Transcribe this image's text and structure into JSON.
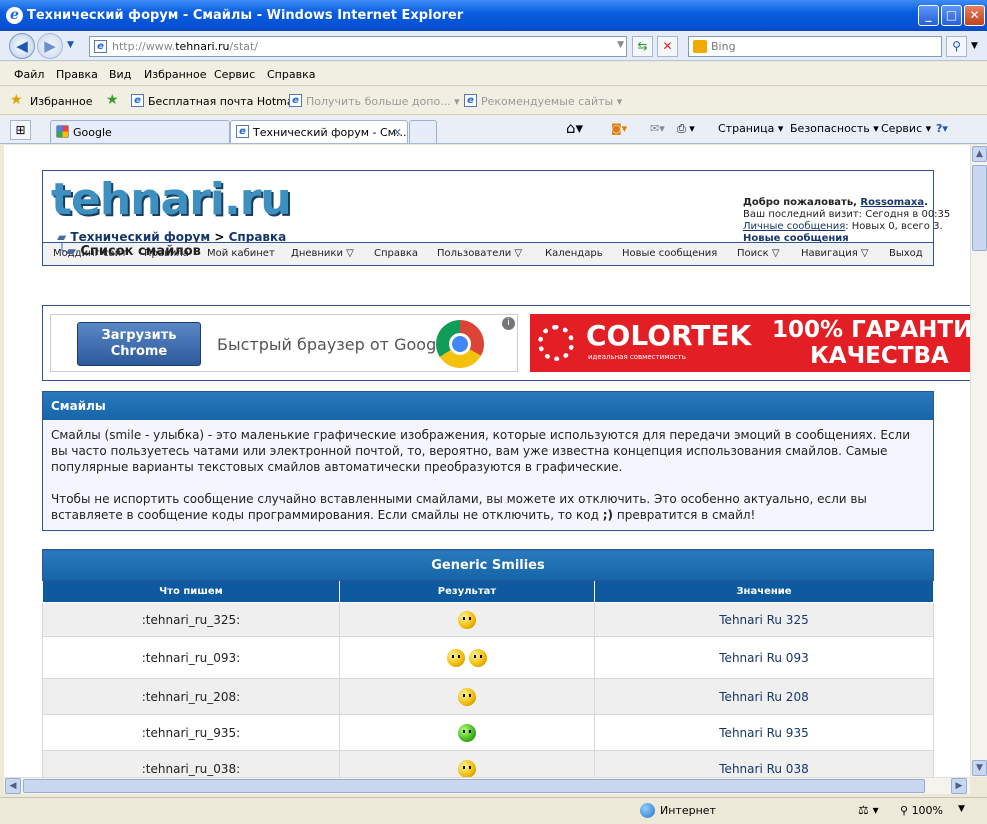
{
  "window": {
    "title": "Технический форум - Смайлы - Windows Internet Explorer",
    "url_prefix": "http://www.",
    "url_domain": "tehnari.ru",
    "url_path": "/stat/",
    "search_placeholder": "Bing"
  },
  "menu": [
    "Файл",
    "Правка",
    "Вид",
    "Избранное",
    "Сервис",
    "Справка"
  ],
  "favorites": {
    "label": "Избранное",
    "items": [
      "Бесплатная почта Hotmail",
      "Получить больше допо...",
      "Рекомендуемые сайты"
    ]
  },
  "tabs": [
    "Google",
    "Технический форум - См..."
  ],
  "commands": [
    "Страница",
    "Безопасность",
    "Сервис"
  ],
  "forum": {
    "logo": "tehnari.ru",
    "breadcrumb_link1": "Технический форум",
    "breadcrumb_sep": ">",
    "breadcrumb_link2": "Справка",
    "page_title": "Список смайлов",
    "welcome_prefix": "Добро пожаловать,",
    "username": "Rossomaxa",
    "last_visit": "Ваш последний визит: Сегодня в 00:35",
    "pm_link": "Личные сообщения",
    "pm_text": ": Новых 0, всего 3.",
    "new_posts": "Новые сообщения",
    "nav": [
      "Моддинг сайт",
      "Правила",
      "Мой кабинет",
      "Дневники",
      "Справка",
      "Пользователи",
      "Календарь",
      "Новые сообщения",
      "Поиск",
      "Навигация",
      "Выход"
    ]
  },
  "ads": {
    "chrome_button": "Загрузить Chrome",
    "chrome_text": "Быстрый браузер от Google",
    "colortek": "COLORTEK",
    "colortek_sub": "идеальная совместимость",
    "colortek_slogan1": "100% ГАРАНТИЯ",
    "colortek_slogan2": "КАЧЕСТВА"
  },
  "smilies_panel": {
    "heading": "Смайлы",
    "para1": "Смайлы (smile - улыбка) - это маленькие графические изображения, которые используются для передачи эмоций в сообщениях. Если вы часто пользуетесь чатами или электронной почтой, то, вероятно, вам уже известна концепция использования смайлов. Самые популярные варианты текстовых смайлов автоматически преобразуются в графические.",
    "para2_before": "Чтобы не испортить сообщение случайно вставленными смайлами, вы можете их отключить. Это особенно актуально, если вы вставляете в сообщение коды программирования. Если смайлы не отключить, то код",
    "para2_code": ";)",
    "para2_after": "превратится в смайл!"
  },
  "table": {
    "caption": "Generic Smilies",
    "columns": [
      "Что пишем",
      "Результат",
      "Значение"
    ],
    "rows": [
      {
        "code": ":tehnari_ru_325:",
        "meaning": "Tehnari Ru 325"
      },
      {
        "code": ":tehnari_ru_093:",
        "meaning": "Tehnari Ru 093"
      },
      {
        "code": ":tehnari_ru_208:",
        "meaning": "Tehnari Ru 208"
      },
      {
        "code": ":tehnari_ru_935:",
        "meaning": "Tehnari Ru 935"
      },
      {
        "code": ":tehnari_ru_038:",
        "meaning": "Tehnari Ru 038"
      }
    ]
  },
  "status": {
    "zone": "Интернет",
    "zoom": "100%"
  }
}
